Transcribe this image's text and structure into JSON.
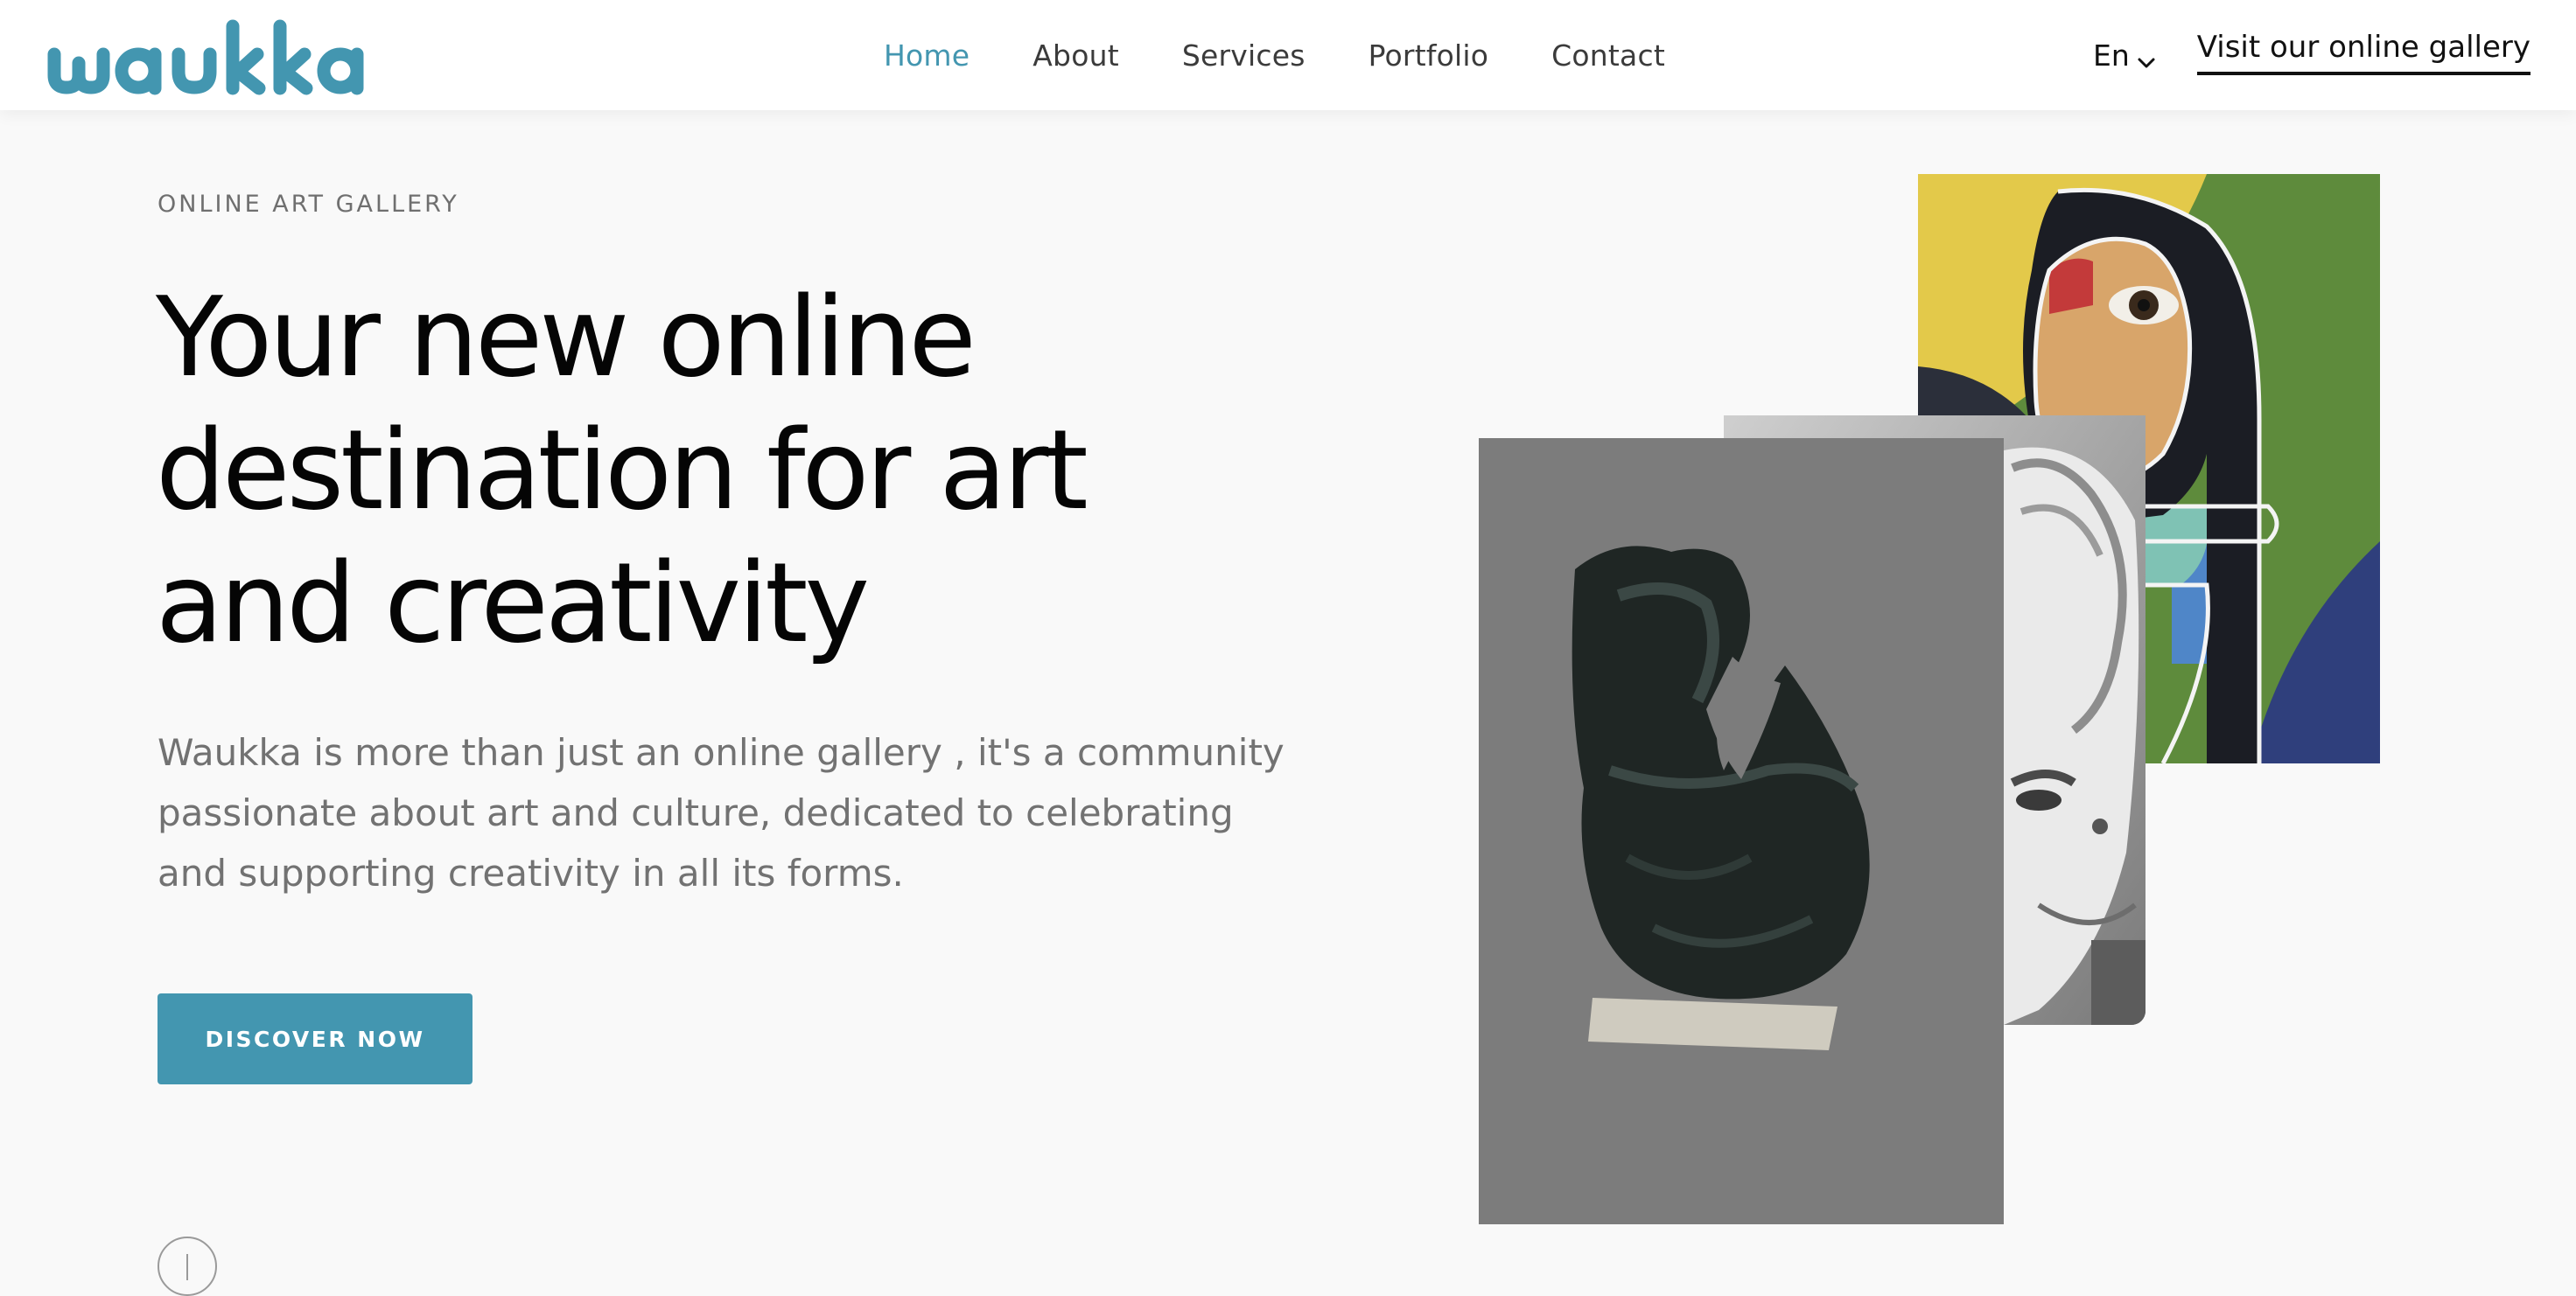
{
  "header": {
    "logo_text": "waukka",
    "nav": [
      {
        "label": "Home",
        "active": true
      },
      {
        "label": "About",
        "active": false
      },
      {
        "label": "Services",
        "active": false
      },
      {
        "label": "Portfolio",
        "active": false
      },
      {
        "label": "Contact",
        "active": false
      }
    ],
    "language": "En",
    "gallery_link": "Visit our online gallery"
  },
  "hero": {
    "eyebrow": "ONLINE ART GALLERY",
    "title": "Your new online destination for art and creativity",
    "description": "Waukka is more than just an online gallery , it's a community passionate about art and culture, dedicated to celebrating and supporting creativity in all its forms.",
    "cta_label": "DISCOVER NOW"
  },
  "artworks": [
    {
      "name": "abstract-face-painting"
    },
    {
      "name": "black-and-white-portrait"
    },
    {
      "name": "dark-bronze-sculpture"
    }
  ],
  "colors": {
    "accent": "#4396b0",
    "page_background": "#f9f9f9",
    "header_background": "#ffffff",
    "text_dark": "#050505",
    "text_muted": "#727272"
  },
  "icons": {
    "language_chevron": "chevron-down-icon",
    "scroll": "scroll-down-icon"
  }
}
